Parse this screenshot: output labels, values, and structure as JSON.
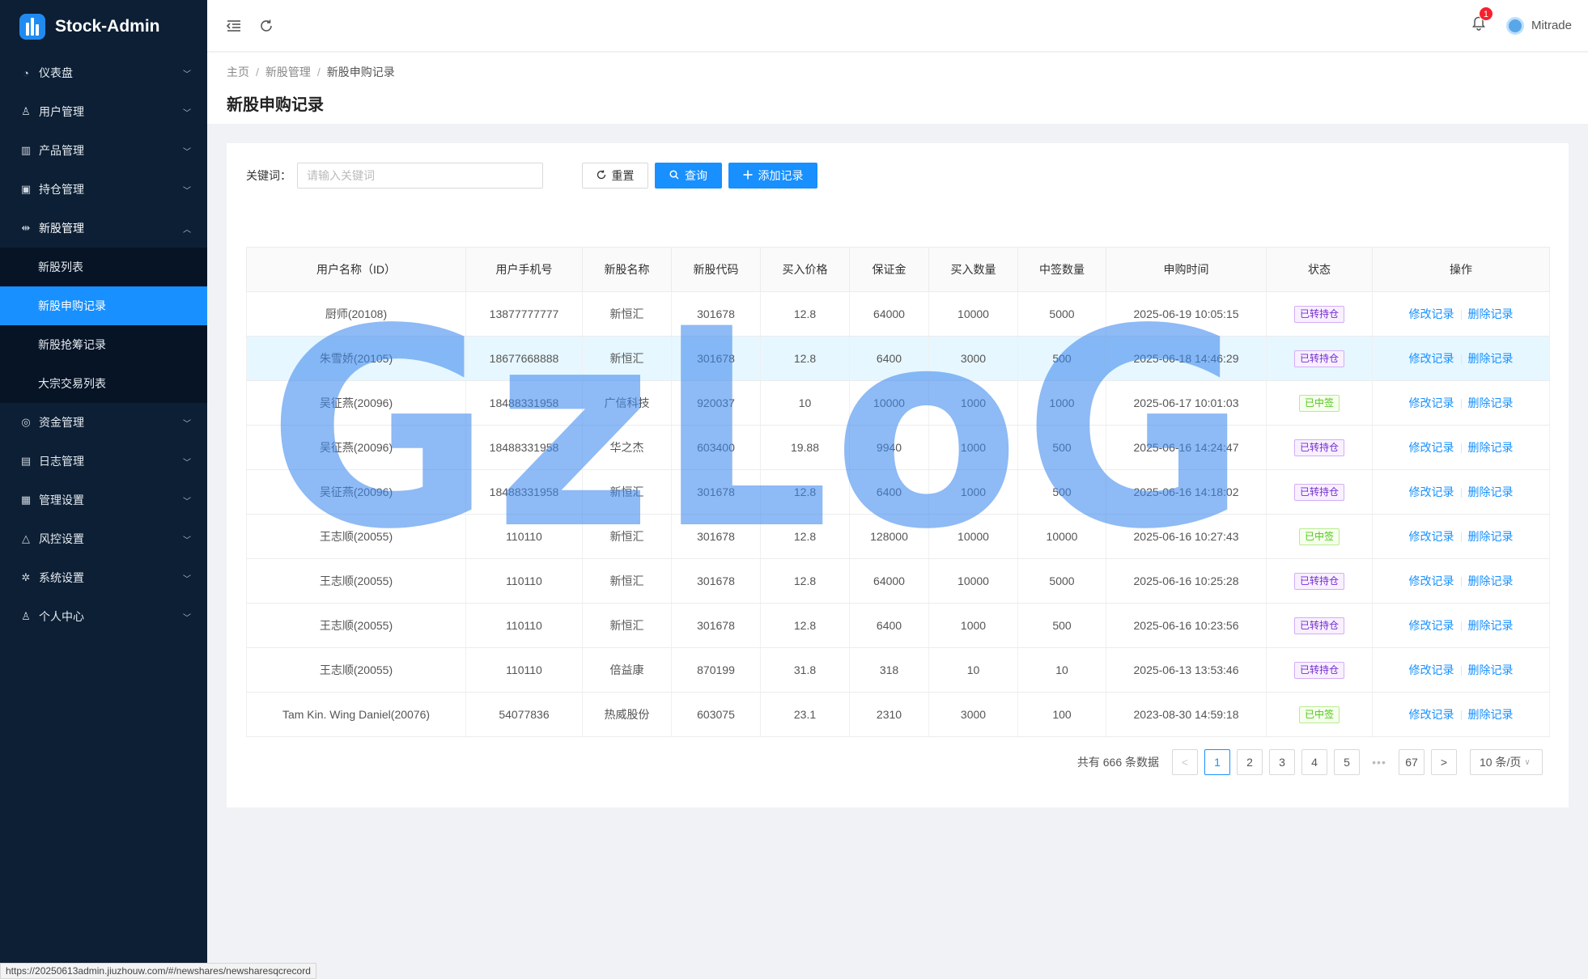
{
  "app": {
    "name": "Stock-Admin"
  },
  "sidebar": {
    "items": [
      {
        "label": "仪表盘",
        "icon": "dashboard-icon"
      },
      {
        "label": "用户管理",
        "icon": "users-icon"
      },
      {
        "label": "产品管理",
        "icon": "chart-icon"
      },
      {
        "label": "持仓管理",
        "icon": "holding-icon"
      },
      {
        "label": "新股管理",
        "icon": "ipo-icon",
        "open": true,
        "children": [
          {
            "label": "新股列表"
          },
          {
            "label": "新股申购记录",
            "active": true
          },
          {
            "label": "新股抢筹记录"
          },
          {
            "label": "大宗交易列表"
          }
        ]
      },
      {
        "label": "资金管理",
        "icon": "funds-icon"
      },
      {
        "label": "日志管理",
        "icon": "log-icon"
      },
      {
        "label": "管理设置",
        "icon": "admin-settings-icon"
      },
      {
        "label": "风控设置",
        "icon": "risk-icon"
      },
      {
        "label": "系统设置",
        "icon": "system-settings-icon"
      },
      {
        "label": "个人中心",
        "icon": "profile-icon"
      }
    ]
  },
  "header": {
    "notification_count": "1",
    "username": "Mitrade"
  },
  "breadcrumb": {
    "home": "主页",
    "parent": "新股管理",
    "current": "新股申购记录"
  },
  "page": {
    "title": "新股申购记录"
  },
  "filters": {
    "keyword_label": "关键词：",
    "keyword_placeholder": "请输入关键词",
    "reset_label": "重置",
    "search_label": "查询",
    "add_label": "添加记录"
  },
  "table": {
    "columns": [
      "用户名称（ID）",
      "用户手机号",
      "新股名称",
      "新股代码",
      "买入价格",
      "保证金",
      "买入数量",
      "中签数量",
      "申购时间",
      "状态",
      "操作"
    ],
    "rows": [
      {
        "user": "厨师(20108)",
        "phone": "13877777777",
        "name": "新恒汇",
        "code": "301678",
        "price": "12.8",
        "deposit": "64000",
        "qty": "10000",
        "won": "5000",
        "time": "2025-06-19 10:05:15",
        "status": "已转持仓",
        "status_color": "purple"
      },
      {
        "user": "朱雪娇(20105)",
        "phone": "18677668888",
        "name": "新恒汇",
        "code": "301678",
        "price": "12.8",
        "deposit": "6400",
        "qty": "3000",
        "won": "500",
        "time": "2025-06-18 14:46:29",
        "status": "已转持仓",
        "status_color": "purple"
      },
      {
        "user": "吴征燕(20096)",
        "phone": "18488331958",
        "name": "广信科技",
        "code": "920037",
        "price": "10",
        "deposit": "10000",
        "qty": "1000",
        "won": "1000",
        "time": "2025-06-17 10:01:03",
        "status": "已中签",
        "status_color": "green"
      },
      {
        "user": "吴征燕(20096)",
        "phone": "18488331958",
        "name": "华之杰",
        "code": "603400",
        "price": "19.88",
        "deposit": "9940",
        "qty": "1000",
        "won": "500",
        "time": "2025-06-16 14:24:47",
        "status": "已转持仓",
        "status_color": "purple"
      },
      {
        "user": "吴征燕(20096)",
        "phone": "18488331958",
        "name": "新恒汇",
        "code": "301678",
        "price": "12.8",
        "deposit": "6400",
        "qty": "1000",
        "won": "500",
        "time": "2025-06-16 14:18:02",
        "status": "已转持仓",
        "status_color": "purple"
      },
      {
        "user": "王志顺(20055)",
        "phone": "110110",
        "name": "新恒汇",
        "code": "301678",
        "price": "12.8",
        "deposit": "128000",
        "qty": "10000",
        "won": "10000",
        "time": "2025-06-16 10:27:43",
        "status": "已中签",
        "status_color": "green"
      },
      {
        "user": "王志顺(20055)",
        "phone": "110110",
        "name": "新恒汇",
        "code": "301678",
        "price": "12.8",
        "deposit": "64000",
        "qty": "10000",
        "won": "5000",
        "time": "2025-06-16 10:25:28",
        "status": "已转持仓",
        "status_color": "purple"
      },
      {
        "user": "王志顺(20055)",
        "phone": "110110",
        "name": "新恒汇",
        "code": "301678",
        "price": "12.8",
        "deposit": "6400",
        "qty": "1000",
        "won": "500",
        "time": "2025-06-16 10:23:56",
        "status": "已转持仓",
        "status_color": "purple"
      },
      {
        "user": "王志顺(20055)",
        "phone": "110110",
        "name": "倍益康",
        "code": "870199",
        "price": "31.8",
        "deposit": "318",
        "qty": "10",
        "won": "10",
        "time": "2025-06-13 13:53:46",
        "status": "已转持仓",
        "status_color": "purple"
      },
      {
        "user": "Tam Kin. Wing Daniel(20076)",
        "phone": "54077836",
        "name": "热威股份",
        "code": "603075",
        "price": "23.1",
        "deposit": "2310",
        "qty": "3000",
        "won": "100",
        "time": "2023-08-30 14:59:18",
        "status": "已中签",
        "status_color": "green"
      }
    ],
    "actions": {
      "edit": "修改记录",
      "delete": "删除记录"
    }
  },
  "pagination": {
    "total_text": "共有 666 条数据",
    "prev": "<",
    "pages": [
      "1",
      "2",
      "3",
      "4",
      "5"
    ],
    "ellipsis": "•••",
    "last": "67",
    "next": ">",
    "page_size": "10 条/页"
  },
  "watermark": "GzLoG",
  "status_url": "https://20250613admin.jiuzhouw.com/#/newshares/newsharesqcrecord"
}
